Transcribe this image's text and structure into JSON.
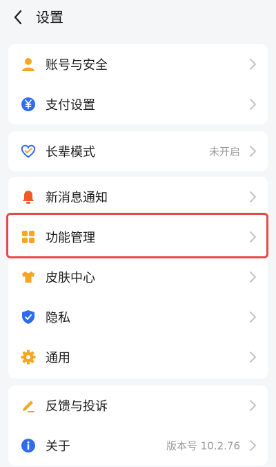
{
  "header": {
    "title": "设置"
  },
  "groups": [
    {
      "items": [
        {
          "label": "账号与安全",
          "icon": "person-icon",
          "value": ""
        },
        {
          "label": "支付设置",
          "icon": "yen-icon",
          "value": ""
        }
      ]
    },
    {
      "items": [
        {
          "label": "长辈模式",
          "icon": "heart-care-icon",
          "value": "未开启"
        }
      ]
    },
    {
      "items": [
        {
          "label": "新消息通知",
          "icon": "bell-icon",
          "value": ""
        },
        {
          "label": "功能管理",
          "icon": "grid-icon",
          "value": ""
        },
        {
          "label": "皮肤中心",
          "icon": "tshirt-icon",
          "value": ""
        },
        {
          "label": "隐私",
          "icon": "shield-icon",
          "value": ""
        },
        {
          "label": "通用",
          "icon": "gear-icon",
          "value": ""
        }
      ]
    },
    {
      "items": [
        {
          "label": "反馈与投诉",
          "icon": "edit-icon",
          "value": ""
        },
        {
          "label": "关于",
          "icon": "info-icon",
          "value": "版本号 10.2.76"
        }
      ]
    }
  ],
  "colors": {
    "orange": "#f5a623",
    "blue": "#2e6cf0",
    "red_bell": "#f05a28",
    "highlight": "#e8484a"
  }
}
